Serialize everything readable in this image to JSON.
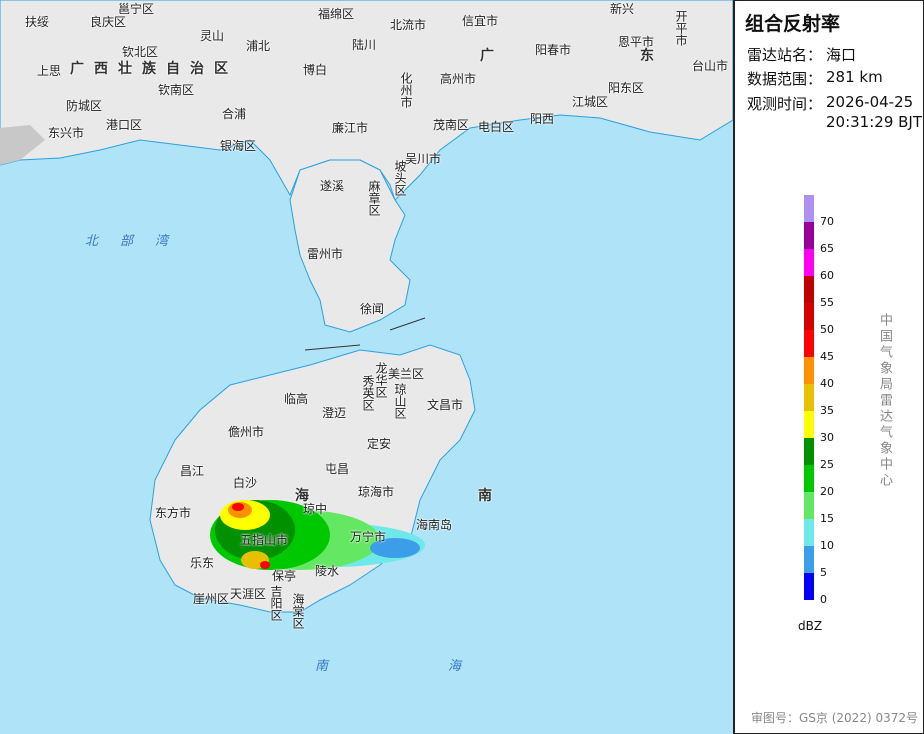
{
  "panel": {
    "title": "组合反射率",
    "station_label": "雷达站名：",
    "station": "海口",
    "range_label": "数据范围：",
    "range": "281 km",
    "time_label": "观测时间：",
    "date": "2026-04-25",
    "time": "20:31:29 BJT",
    "legend_unit": "dBZ",
    "legend": [
      {
        "value": "70",
        "color": "#ad90f0"
      },
      {
        "value": "65",
        "color": "#96009b"
      },
      {
        "value": "60",
        "color": "#ff00f0"
      },
      {
        "value": "55",
        "color": "#c00000"
      },
      {
        "value": "50",
        "color": "#d60000"
      },
      {
        "value": "45",
        "color": "#ff0000"
      },
      {
        "value": "40",
        "color": "#ff9000"
      },
      {
        "value": "35",
        "color": "#e7c000"
      },
      {
        "value": "30",
        "color": "#ffff00"
      },
      {
        "value": "25",
        "color": "#009000"
      },
      {
        "value": "20",
        "color": "#00c800"
      },
      {
        "value": "15",
        "color": "#64e864"
      },
      {
        "value": "10",
        "color": "#6ee8e8"
      },
      {
        "value": "5",
        "color": "#3c9ee8"
      },
      {
        "value": "0",
        "color": "#0000f6"
      }
    ],
    "agency": "中国气象局雷达气象中心",
    "approval": "审图号：GS京 (2022) 0372号"
  },
  "map": {
    "provinces": [
      "广西壮族自治区",
      "广",
      "东",
      "海",
      "南"
    ],
    "seas": [
      "北部湾",
      "南海"
    ],
    "places": [
      "扶绥",
      "良庆区",
      "邕宁区",
      "灵山",
      "福绵区",
      "北流市",
      "信宜市",
      "新兴",
      "开平市",
      "钦北区",
      "浦北",
      "陆川",
      "阳春市",
      "恩平市",
      "台山市",
      "上思",
      "博白",
      "化州市",
      "高州市",
      "钦南区",
      "阳东区",
      "防城区",
      "合浦",
      "江城区",
      "东兴市",
      "港口区",
      "廉江市",
      "茂南区",
      "电白区",
      "阳西",
      "银海区",
      "吴川市",
      "遂溪",
      "麻章区",
      "坡头区",
      "雷州市",
      "徐闻",
      "龙华区",
      "美兰区",
      "秀英区",
      "琼山区",
      "临高",
      "澄迈",
      "文昌市",
      "儋州市",
      "定安",
      "昌江",
      "屯昌",
      "琼海市",
      "白沙",
      "东方市",
      "琼中",
      "万宁市",
      "海南岛",
      "五指山市",
      "乐东",
      "保亭",
      "陵水",
      "崖州区",
      "天涯区",
      "吉阳区",
      "海棠区"
    ]
  }
}
